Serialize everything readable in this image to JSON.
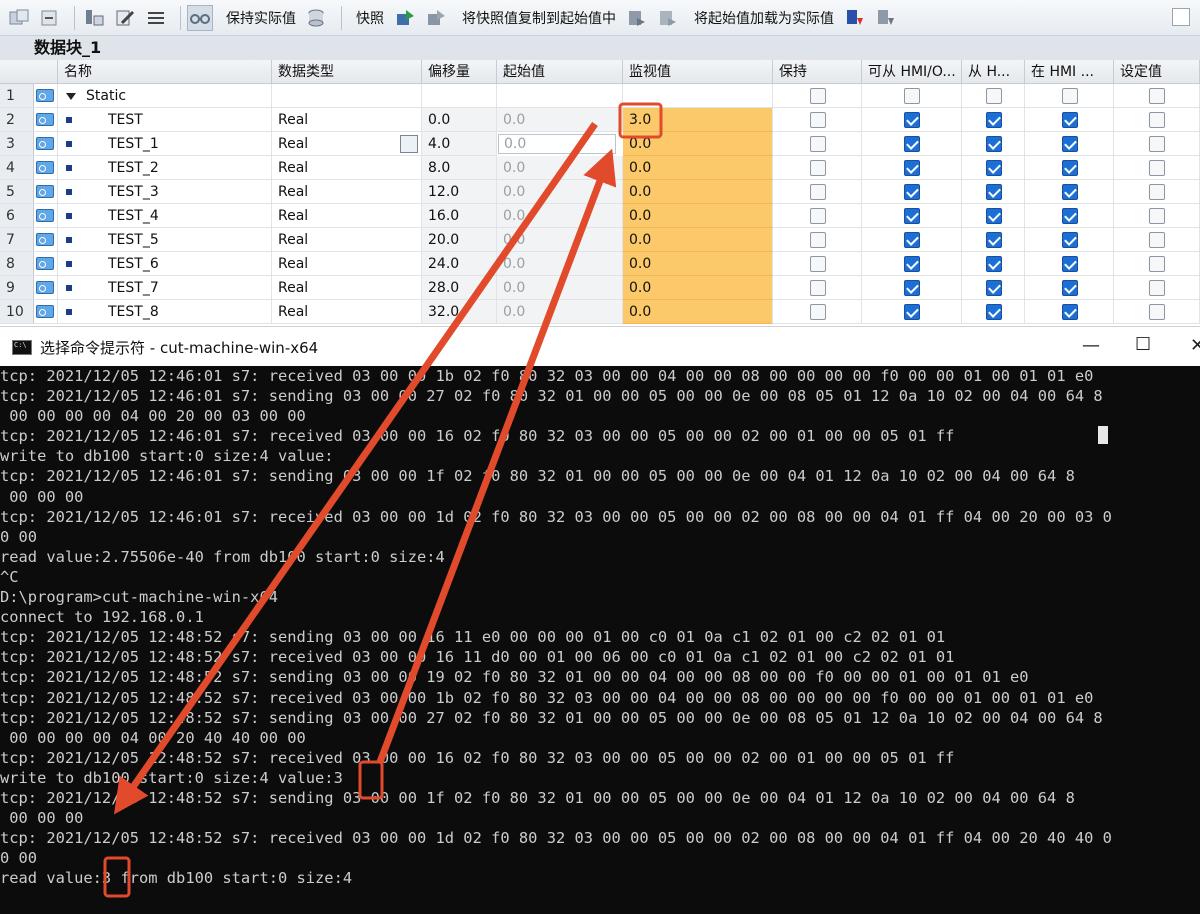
{
  "toolbar": {
    "keep_actual_label": "保持实际值",
    "snapshot_label": "快照",
    "copy_snapshot_label": "将快照值复制到起始值中",
    "load_start_label": "将起始值加载为实际值"
  },
  "db_title": "数据块_1",
  "table": {
    "headers": [
      "名称",
      "数据类型",
      "偏移量",
      "起始值",
      "监视值",
      "保持",
      "可从 HMI/O...",
      "从 H...",
      "在 HMI ...",
      "设定值"
    ],
    "static_row": {
      "num": "1",
      "name": "Static"
    },
    "rows": [
      {
        "num": "2",
        "name": "TEST",
        "type": "Real",
        "offset": "0.0",
        "start": "0.0",
        "monitor": "3.0"
      },
      {
        "num": "3",
        "name": "TEST_1",
        "type": "Real",
        "offset": "4.0",
        "start": "0.0",
        "monitor": "0.0"
      },
      {
        "num": "4",
        "name": "TEST_2",
        "type": "Real",
        "offset": "8.0",
        "start": "0.0",
        "monitor": "0.0"
      },
      {
        "num": "5",
        "name": "TEST_3",
        "type": "Real",
        "offset": "12.0",
        "start": "0.0",
        "monitor": "0.0"
      },
      {
        "num": "6",
        "name": "TEST_4",
        "type": "Real",
        "offset": "16.0",
        "start": "0.0",
        "monitor": "0.0"
      },
      {
        "num": "7",
        "name": "TEST_5",
        "type": "Real",
        "offset": "20.0",
        "start": "0.0",
        "monitor": "0.0"
      },
      {
        "num": "8",
        "name": "TEST_6",
        "type": "Real",
        "offset": "24.0",
        "start": "0.0",
        "monitor": "0.0"
      },
      {
        "num": "9",
        "name": "TEST_7",
        "type": "Real",
        "offset": "28.0",
        "start": "0.0",
        "monitor": "0.0"
      },
      {
        "num": "10",
        "name": "TEST_8",
        "type": "Real",
        "offset": "32.0",
        "start": "0.0",
        "monitor": "0.0"
      }
    ]
  },
  "console": {
    "title": "选择命令提示符 - cut-machine-win-x64",
    "lines": [
      "tcp: 2021/12/05 12:46:01 s7: received 03 00 00 1b 02 f0 80 32 03 00 00 04 00 00 08 00 00 00 00 f0 00 00 01 00 01 01 e0",
      "tcp: 2021/12/05 12:46:01 s7: sending 03 00 00 27 02 f0 80 32 01 00 00 05 00 00 0e 00 08 05 01 12 0a 10 02 00 04 00 64 8",
      " 00 00 00 00 04 00 20 00 03 00 00",
      "tcp: 2021/12/05 12:46:01 s7: received 03 00 00 16 02 f0 80 32 03 00 00 05 00 00 02 00 01 00 00 05 01 ff",
      "write to db100 start:0 size:4 value:",
      "tcp: 2021/12/05 12:46:01 s7: sending 03 00 00 1f 02 f0 80 32 01 00 00 05 00 00 0e 00 04 01 12 0a 10 02 00 04 00 64 8",
      " 00 00 00",
      "tcp: 2021/12/05 12:46:01 s7: received 03 00 00 1d 02 f0 80 32 03 00 00 05 00 00 02 00 08 00 00 04 01 ff 04 00 20 00 03 0",
      "0 00",
      "read value:2.75506e-40 from db100 start:0 size:4",
      "^C",
      "D:\\program>cut-machine-win-x64",
      "connect to 192.168.0.1",
      "tcp: 2021/12/05 12:48:52 s7: sending 03 00 00 16 11 e0 00 00 00 01 00 c0 01 0a c1 02 01 00 c2 02 01 01",
      "tcp: 2021/12/05 12:48:52 s7: received 03 00 00 16 11 d0 00 01 00 06 00 c0 01 0a c1 02 01 00 c2 02 01 01",
      "tcp: 2021/12/05 12:48:52 s7: sending 03 00 00 19 02 f0 80 32 01 00 00 04 00 00 08 00 00 f0 00 00 01 00 01 01 e0",
      "tcp: 2021/12/05 12:48:52 s7: received 03 00 00 1b 02 f0 80 32 03 00 00 04 00 00 08 00 00 00 00 f0 00 00 01 00 01 01 e0",
      "tcp: 2021/12/05 12:48:52 s7: sending 03 00 00 27 02 f0 80 32 01 00 00 05 00 00 0e 00 08 05 01 12 0a 10 02 00 04 00 64 8",
      " 00 00 00 00 04 00 20 40 40 00 00",
      "tcp: 2021/12/05 12:48:52 s7: received 03 00 00 16 02 f0 80 32 03 00 00 05 00 00 02 00 01 00 00 05 01 ff",
      "write to db100 start:0 size:4 value:3",
      "tcp: 2021/12/05 12:48:52 s7: sending 03 00 00 1f 02 f0 80 32 01 00 00 05 00 00 0e 00 04 01 12 0a 10 02 00 04 00 64 8",
      " 00 00 00",
      "tcp: 2021/12/05 12:48:52 s7: received 03 00 00 1d 02 f0 80 32 03 00 00 05 00 00 02 00 08 00 00 04 01 ff 04 00 20 40 40 0",
      "0 00",
      "read value:3 from db100 start:0 size:4"
    ]
  },
  "colors": {
    "monitor_bg": "#fbc96a",
    "annotation_red": "#e24a2c",
    "checkbox_blue": "#1c6fd6",
    "console_bg": "#0c0c0c"
  }
}
